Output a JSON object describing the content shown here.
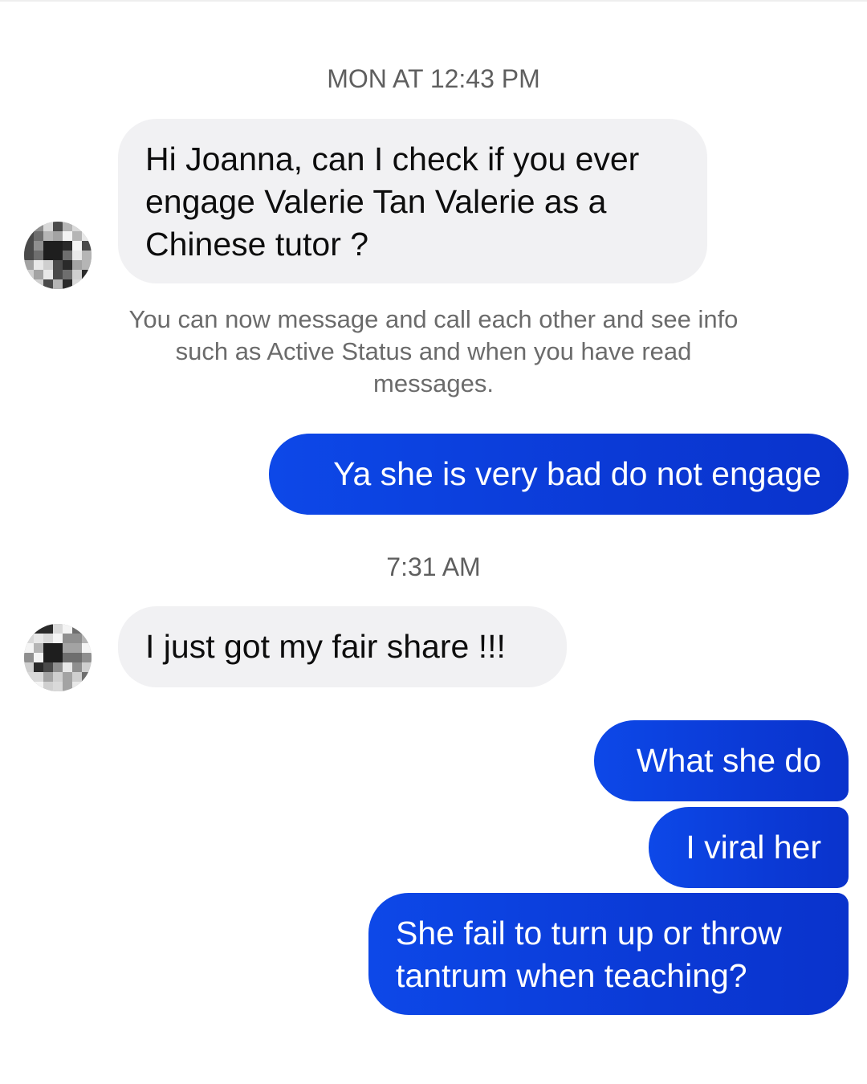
{
  "conversation": {
    "timestamp_1": "MON AT 12:43 PM",
    "incoming_1": "Hi Joanna, can I check if you ever\nengage Valerie Tan Valerie as a\nChinese tutor ?",
    "system_note": "You can now message and call each other and see info such as Active Status and when you have read messages.",
    "outgoing_1": "Ya she is very bad do not engage",
    "timestamp_2": "7:31 AM",
    "incoming_2": "I just got my fair share !!!",
    "outgoing_2": "What she do",
    "outgoing_3": "I viral her",
    "outgoing_4": "She fail to turn up or throw\ntantrum when teaching?"
  },
  "colors": {
    "outgoing_bubble": "#0b3ad6",
    "incoming_bubble": "#f1f1f3",
    "timestamp_text": "#5f5f5f"
  },
  "icons": {
    "avatar": "blurred-profile-avatar"
  }
}
